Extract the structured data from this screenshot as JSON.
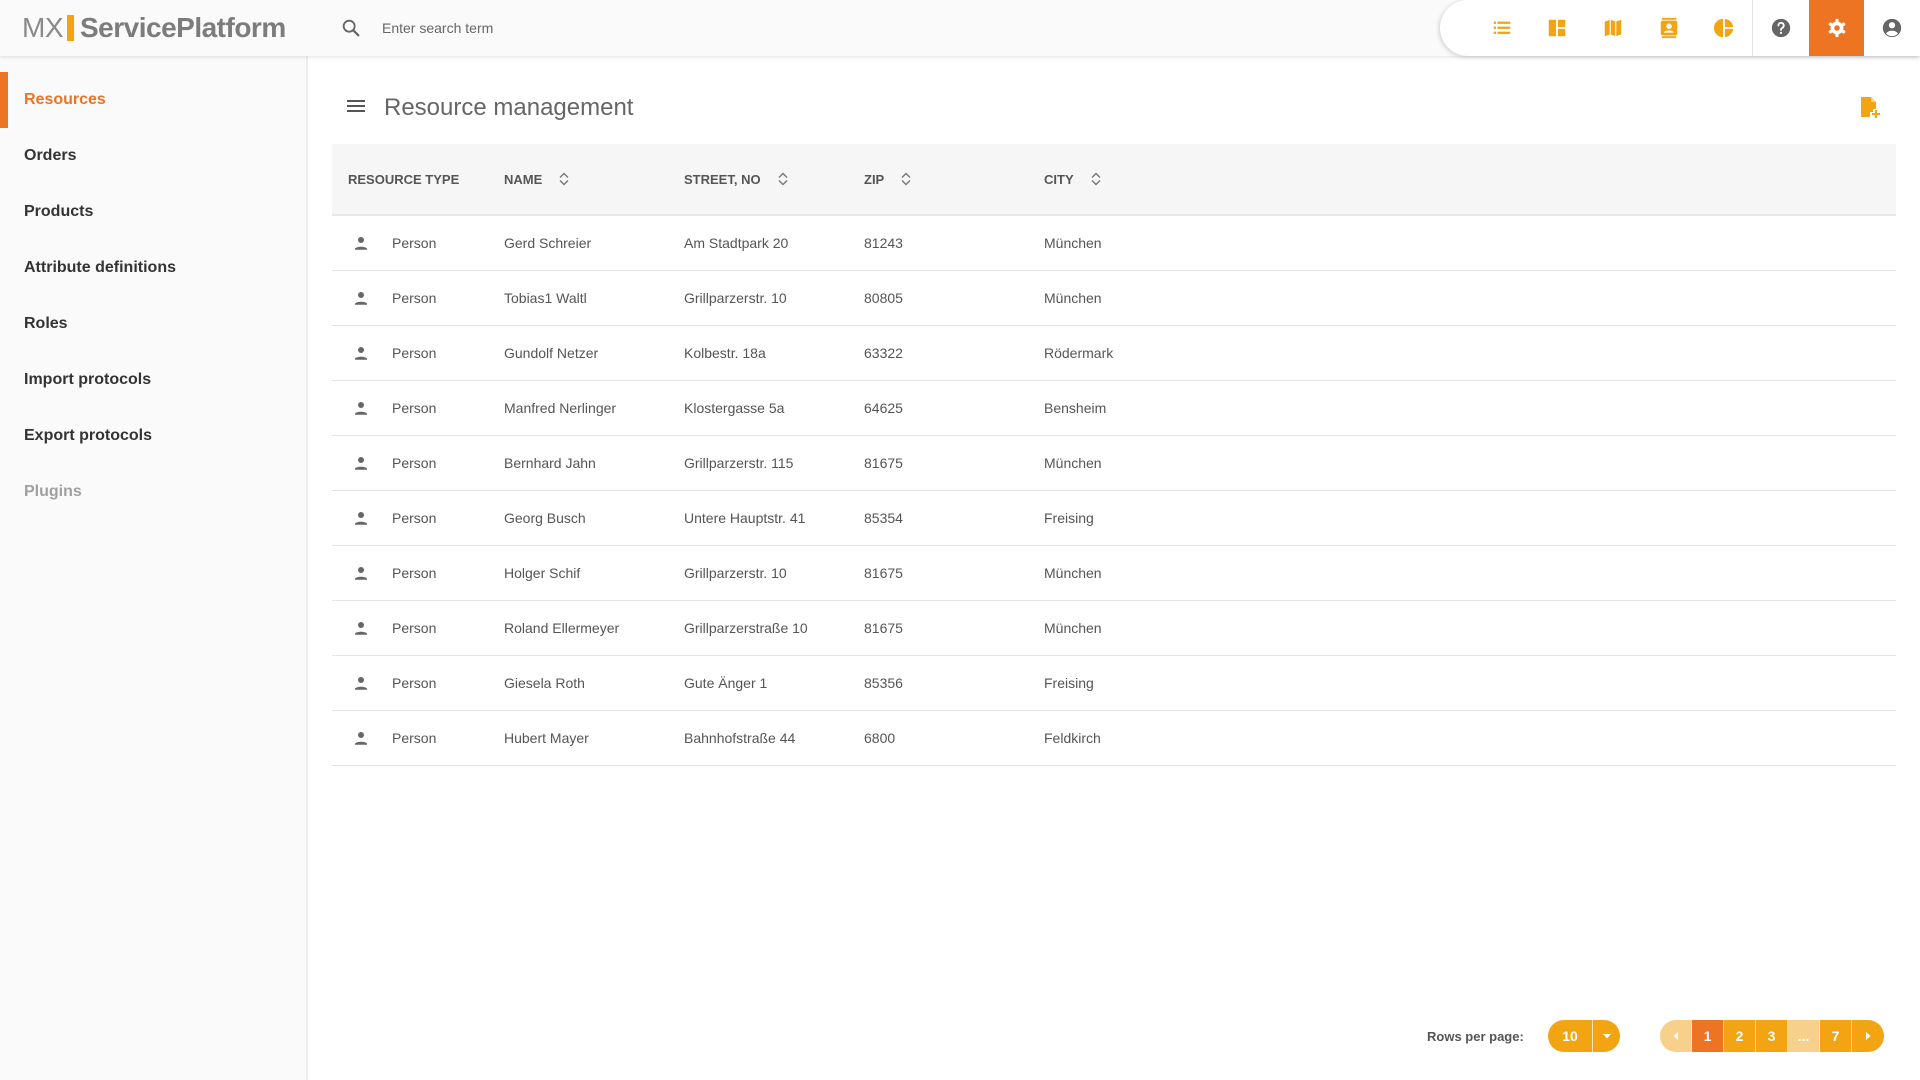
{
  "app": {
    "logo_mx": "MX",
    "logo_name": "ServicePlatform"
  },
  "search": {
    "placeholder": "Enter search term"
  },
  "toolbar": {
    "icons": [
      "list-icon",
      "dashboard-icon",
      "map-icon",
      "contacts-icon",
      "pie-chart-icon",
      "help-icon",
      "settings-icon",
      "account-icon"
    ],
    "active": "settings-icon"
  },
  "sidebar": {
    "items": [
      {
        "label": "Resources",
        "state": "active"
      },
      {
        "label": "Orders",
        "state": "normal"
      },
      {
        "label": "Products",
        "state": "normal"
      },
      {
        "label": "Attribute definitions",
        "state": "normal"
      },
      {
        "label": "Roles",
        "state": "normal"
      },
      {
        "label": "Import protocols",
        "state": "normal"
      },
      {
        "label": "Export protocols",
        "state": "normal"
      },
      {
        "label": "Plugins",
        "state": "disabled"
      }
    ]
  },
  "main": {
    "title": "Resource management",
    "table": {
      "headers": [
        "RESOURCE TYPE",
        "NAME",
        "STREET, NO",
        "ZIP",
        "CITY"
      ],
      "rows": [
        {
          "type": "Person",
          "name": "Gerd Schreier",
          "street": "Am Stadtpark 20",
          "zip": "81243",
          "city": "München"
        },
        {
          "type": "Person",
          "name": "Tobias1 Waltl",
          "street": "Grillparzerstr. 10",
          "zip": "80805",
          "city": "München"
        },
        {
          "type": "Person",
          "name": "Gundolf Netzer",
          "street": "Kolbestr. 18a",
          "zip": "63322",
          "city": "Rödermark"
        },
        {
          "type": "Person",
          "name": "Manfred Nerlinger",
          "street": "Klostergasse 5a",
          "zip": "64625",
          "city": "Bensheim"
        },
        {
          "type": "Person",
          "name": "Bernhard Jahn",
          "street": "Grillparzerstr. 115",
          "zip": "81675",
          "city": "München"
        },
        {
          "type": "Person",
          "name": "Georg Busch",
          "street": "Untere Hauptstr. 41",
          "zip": "85354",
          "city": "Freising"
        },
        {
          "type": "Person",
          "name": "Holger Schif",
          "street": "Grillparzerstr. 10",
          "zip": "81675",
          "city": "München"
        },
        {
          "type": "Person",
          "name": "Roland Ellermeyer",
          "street": "Grillparzerstraße 10",
          "zip": "81675",
          "city": "München"
        },
        {
          "type": "Person",
          "name": "Giesela Roth",
          "street": "Gute Änger 1",
          "zip": "85356",
          "city": "Freising"
        },
        {
          "type": "Person",
          "name": "Hubert Mayer",
          "street": "Bahnhofstraße 44",
          "zip": "6800",
          "city": "Feldkirch"
        }
      ]
    },
    "pagination": {
      "rows_per_page_label": "Rows per page:",
      "rows_per_page": "10",
      "pages": [
        "1",
        "2",
        "3",
        "...",
        "7"
      ],
      "current_page": "1"
    }
  },
  "colors": {
    "accent": "#ec7423",
    "accent_light": "#f2a413"
  }
}
